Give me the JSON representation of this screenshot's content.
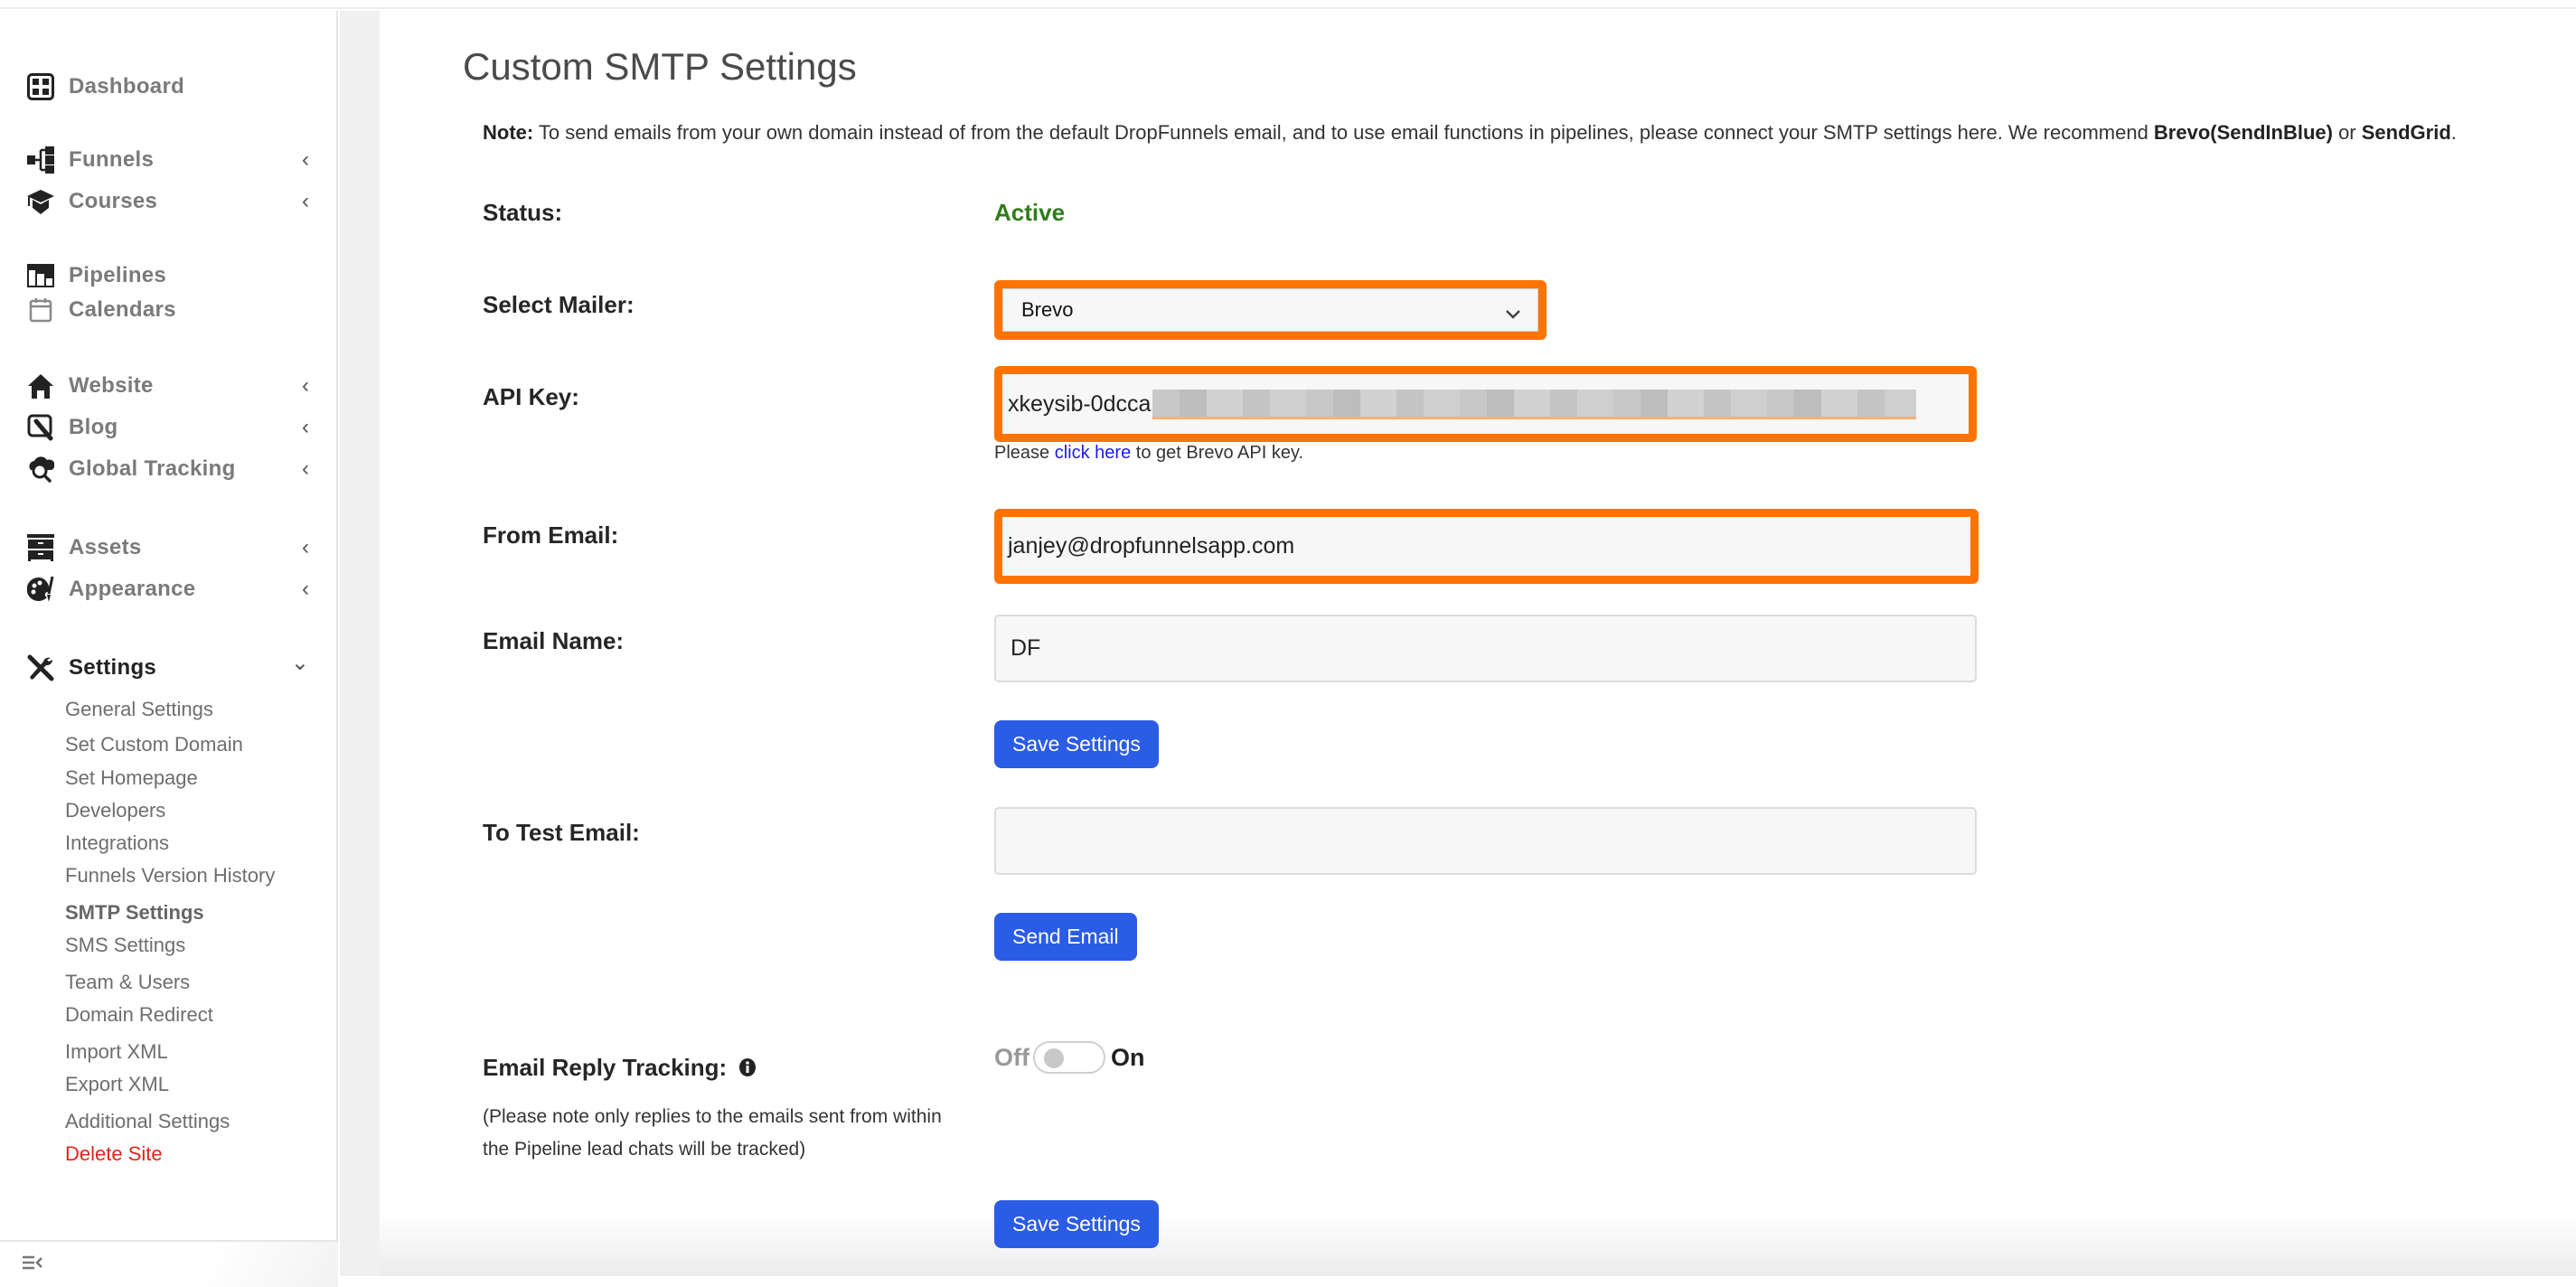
{
  "sidebar": {
    "items": [
      {
        "label": "Dashboard",
        "icon": "dashboard-icon",
        "chevron": ""
      },
      {
        "label": "Funnels",
        "icon": "funnels-icon",
        "chevron": "‹"
      },
      {
        "label": "Courses",
        "icon": "graduation-cap-icon",
        "chevron": "‹"
      },
      {
        "label": "Pipelines",
        "icon": "pipelines-icon",
        "chevron": ""
      },
      {
        "label": "Calendars",
        "icon": "calendar-icon",
        "chevron": ""
      },
      {
        "label": "Website",
        "icon": "home-icon",
        "chevron": "‹"
      },
      {
        "label": "Blog",
        "icon": "blog-edit-icon",
        "chevron": "‹"
      },
      {
        "label": "Global Tracking",
        "icon": "cloud-search-icon",
        "chevron": "‹"
      },
      {
        "label": "Assets",
        "icon": "drawer-icon",
        "chevron": "‹"
      },
      {
        "label": "Appearance",
        "icon": "palette-icon",
        "chevron": "‹"
      },
      {
        "label": "Settings",
        "icon": "tools-icon",
        "chevron": "⌄"
      }
    ],
    "settings_submenu": [
      "General Settings",
      "Set Custom Domain",
      "Set Homepage",
      "Developers",
      "Integrations",
      "Funnels Version History",
      "SMTP Settings",
      "SMS Settings",
      "Team & Users",
      "Domain Redirect",
      "Import XML",
      "Export XML",
      "Additional Settings",
      "Delete Site"
    ],
    "active_submenu": "SMTP Settings",
    "collapse_icon": "collapse-menu-icon"
  },
  "main": {
    "title": "Custom SMTP Settings",
    "note": {
      "label": "Note:",
      "text": " To send emails from your own domain instead of from the default DropFunnels email, and to use email functions in pipelines, please connect your SMTP settings here. We recommend ",
      "rec1": "Brevo(SendInBlue)",
      "or": " or ",
      "rec2": "SendGrid",
      "end": "."
    },
    "status": {
      "label": "Status:",
      "value": "Active",
      "color": "#2e7d1b"
    },
    "mailer": {
      "label": "Select Mailer:",
      "value": "Brevo"
    },
    "api_key": {
      "label": "API Key:",
      "value_visible": "xkeysib-0dcca",
      "helper_pre": "Please ",
      "helper_link": "click here",
      "helper_post": " to get Brevo API key."
    },
    "from_email": {
      "label": "From Email:",
      "value": "janjey@dropfunnelsapp.com"
    },
    "email_name": {
      "label": "Email Name:",
      "value": "DF"
    },
    "save_button": "Save Settings",
    "test_email": {
      "label": "To Test Email:",
      "value": ""
    },
    "send_button": "Send Email",
    "reply_tracking": {
      "label": "Email Reply Tracking:",
      "off_label": "Off",
      "on_label": "On",
      "enabled": false,
      "note": "(Please note only replies to the emails sent from within the Pipeline lead chats will be tracked)"
    },
    "save_button_2": "Save Settings"
  },
  "colors": {
    "highlight": "#ff7300",
    "button": "#2b5ce6",
    "danger": "#e3241b",
    "link": "#1a1ae6"
  }
}
